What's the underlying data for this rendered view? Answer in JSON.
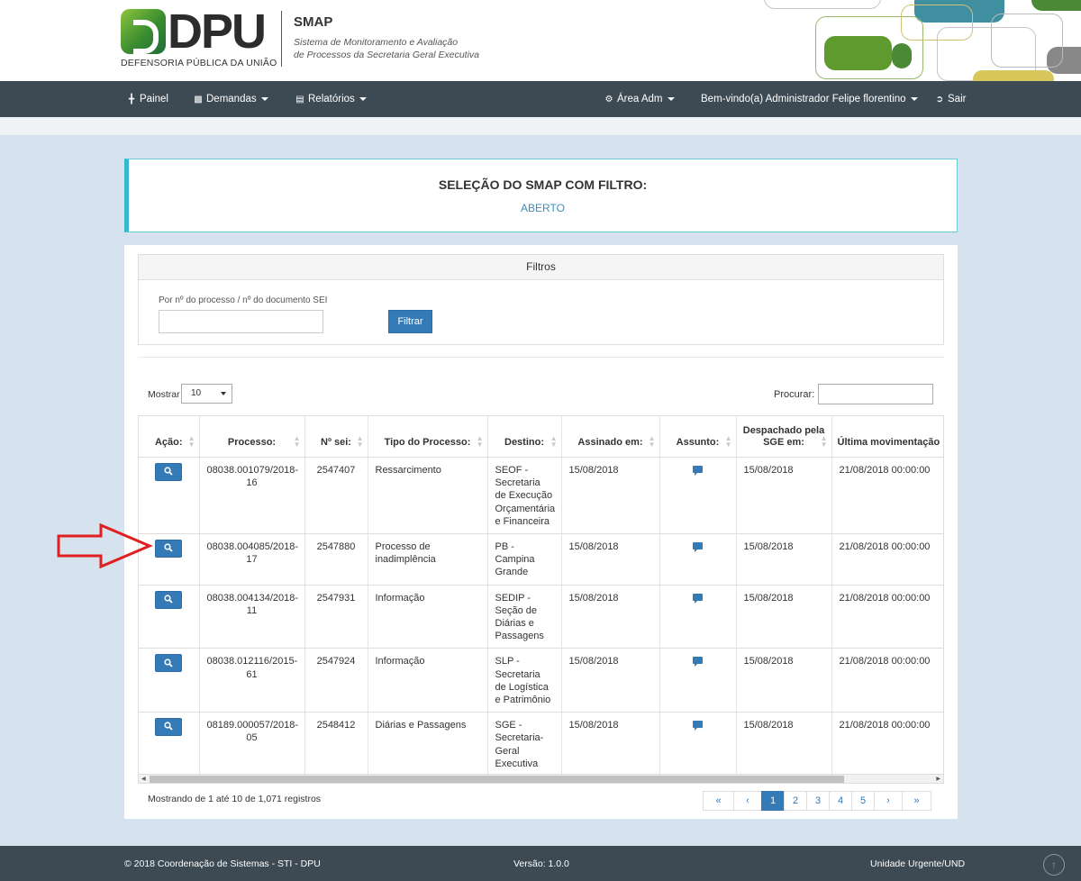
{
  "header": {
    "logo_text": "DPU",
    "logo_subtitle": "DEFENSORIA PÚBLICA DA UNIÃO",
    "app_name": "SMAP",
    "app_description_line1": "Sistema de Monitoramento e Avaliação",
    "app_description_line2": "de Processos da Secretaria Geral Executiva"
  },
  "nav": {
    "painel": "Painel",
    "demandas": "Demandas",
    "relatorios": "Relatórios",
    "area_adm": "Área Adm",
    "welcome": "Bem-vindo(a) Administrador Felipe florentino",
    "sair": "Sair"
  },
  "title_box": {
    "heading": "SELEÇÃO DO SMAP COM FILTRO:",
    "status": "ABERTO"
  },
  "filters": {
    "header": "Filtros",
    "field_label": "Por nº do processo / nº do documento SEI",
    "field_value": "",
    "button": "Filtrar"
  },
  "table_controls": {
    "show_label": "Mostrar",
    "show_value": "10",
    "search_label": "Procurar:",
    "search_value": ""
  },
  "table": {
    "columns": [
      "Ação:",
      "Processo:",
      "Nº sei:",
      "Tipo do Processo:",
      "Destino:",
      "Assinado em:",
      "Assunto:",
      "Despachado pela SGE em:",
      "Última movimentação"
    ],
    "rows": [
      {
        "processo": "08038.001079/2018-16",
        "sei": "2547407",
        "tipo": "Ressarcimento",
        "destino": "SEOF - Secretaria de Execução Orçamentária e Financeira",
        "assinado": "15/08/2018",
        "despachado": "15/08/2018",
        "ultima": "21/08/2018 00:00:00"
      },
      {
        "processo": "08038.004085/2018-17",
        "sei": "2547880",
        "tipo": "Processo de inadimplência",
        "destino": "PB - Campina Grande",
        "assinado": "15/08/2018",
        "despachado": "15/08/2018",
        "ultima": "21/08/2018 00:00:00"
      },
      {
        "processo": "08038.004134/2018-11",
        "sei": "2547931",
        "tipo": "Informação",
        "destino": "SEDIP - Seção de Diárias e Passagens",
        "assinado": "15/08/2018",
        "despachado": "15/08/2018",
        "ultima": "21/08/2018 00:00:00"
      },
      {
        "processo": "08038.012116/2015-61",
        "sei": "2547924",
        "tipo": "Informação",
        "destino": "SLP - Secretaria de Logística e Patrimônio",
        "assinado": "15/08/2018",
        "despachado": "15/08/2018",
        "ultima": "21/08/2018 00:00:00"
      },
      {
        "processo": "08189.000057/2018-05",
        "sei": "2548412",
        "tipo": "Diárias e Passagens",
        "destino": "SGE - Secretaria-Geral Executiva",
        "assinado": "15/08/2018",
        "despachado": "15/08/2018",
        "ultima": "21/08/2018 00:00:00"
      }
    ]
  },
  "pagination": {
    "info": "Mostrando de 1 até 10 de 1,071 registros",
    "first": "«",
    "prev": "‹",
    "pages": [
      "1",
      "2",
      "3",
      "4",
      "5"
    ],
    "active_page": "1",
    "next": "›",
    "last": "»"
  },
  "footer": {
    "copyright": "© 2018 Coordenação de Sistemas - STI - DPU",
    "version": "Versão: 1.0.0",
    "unit": "Unidade Urgente/UND"
  },
  "colors": {
    "navbar": "#3d4a54",
    "primary": "#337ab7",
    "accent": "#36b9cc",
    "page_bg": "#d6e3ef",
    "annotation_arrow": "#e02020"
  }
}
